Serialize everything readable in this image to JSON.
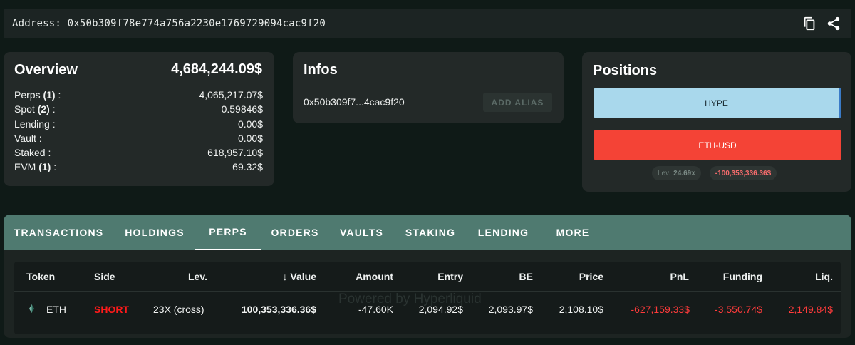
{
  "address_bar": {
    "label": "Address: 0x50b309f78e774a756a2230e1769729094cac9f20",
    "icons": [
      "copy-icon",
      "share-icon"
    ]
  },
  "overview": {
    "title": "Overview",
    "total": "4,684,244.09$",
    "rows": [
      {
        "label": "Perps",
        "count": "(1)",
        "suffix": " :",
        "value": "4,065,217.07$"
      },
      {
        "label": "Spot",
        "count": "(2)",
        "suffix": " :",
        "value": "0.59846$"
      },
      {
        "label": "Lending",
        "count": "",
        "suffix": " :",
        "value": "0.00$"
      },
      {
        "label": "Vault",
        "count": "",
        "suffix": " :",
        "value": "0.00$"
      },
      {
        "label": "Staked",
        "count": "",
        "suffix": " :",
        "value": "618,957.10$"
      },
      {
        "label": "EVM",
        "count": "(1)",
        "suffix": " :",
        "value": "69.32$"
      }
    ]
  },
  "infos": {
    "title": "Infos",
    "short_address": "0x50b309f7...4cac9f20",
    "alias_button": "ADD ALIAS"
  },
  "positions": {
    "title": "Positions",
    "items": [
      "HYPE",
      "ETH-USD"
    ],
    "leverage_label": "Lev.",
    "leverage_value": "24.69x",
    "pnl": "-100,353,336.36$"
  },
  "tabs": [
    "TRANSACTIONS",
    "HOLDINGS",
    "PERPS",
    "ORDERS",
    "VAULTS",
    "STAKING",
    "LENDING",
    "MORE"
  ],
  "active_tab": "PERPS",
  "table": {
    "headers": [
      "Token",
      "Side",
      "Lev.",
      "Value",
      "Amount",
      "Entry",
      "BE",
      "Price",
      "PnL",
      "Funding",
      "Liq."
    ],
    "sort_icon": "arrow-down-icon",
    "rows": [
      {
        "token": "ETH",
        "side": "SHORT",
        "lev": "23X (cross)",
        "value": "100,353,336.36$",
        "amount": "-47.60K",
        "entry": "2,094.92$",
        "be": "2,093.97$",
        "price": "2,108.10$",
        "pnl": "-627,159.33$",
        "funding": "-3,550.74$",
        "liq": "2,149.84$"
      }
    ],
    "watermark": "Powered by Hyperliquid"
  },
  "colors": {
    "background": "#0f1a17",
    "card": "#232928",
    "tab_bar": "#4f7a70",
    "short": "#ff1a1a",
    "negative": "#ff3b3b",
    "hype": "#a9d8ec",
    "eth": "#f44336"
  }
}
